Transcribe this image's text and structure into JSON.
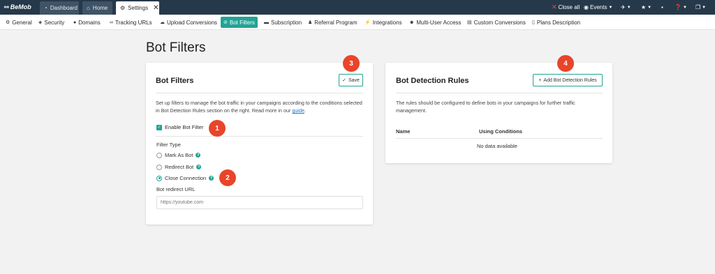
{
  "app": {
    "logo": "BeMob"
  },
  "top_tabs": [
    {
      "label": "Dashboard"
    },
    {
      "label": "Home"
    },
    {
      "label": "Settings"
    }
  ],
  "top_right": {
    "close_all": "Close all",
    "events": "Events"
  },
  "nav": [
    {
      "label": "General"
    },
    {
      "label": "Security"
    },
    {
      "label": "Domains"
    },
    {
      "label": "Tracking URLs"
    },
    {
      "label": "Upload Conversions"
    },
    {
      "label": "Bot Filters"
    },
    {
      "label": "Subscription"
    },
    {
      "label": "Referral Program"
    },
    {
      "label": "Integrations"
    },
    {
      "label": "Multi-User Access"
    },
    {
      "label": "Custom Conversions"
    },
    {
      "label": "Plans Description"
    }
  ],
  "page": {
    "title": "Bot Filters"
  },
  "bot_filters": {
    "title": "Bot Filters",
    "save_label": "Save",
    "description": "Set up filters to manage the bot traffic in your campaigns according to the conditions selected in Bot Detection Rules section on the right. Read more in our",
    "description_link": "guide",
    "enable_label": "Enable Bot Filter",
    "enabled": true,
    "filter_type_label": "Filter Type",
    "options": [
      {
        "label": "Mark As Bot",
        "selected": false
      },
      {
        "label": "Redirect Bot",
        "selected": false
      },
      {
        "label": "Close Connection",
        "selected": true
      }
    ],
    "redirect_url_label": "Bot redirect URL",
    "redirect_url_placeholder": "https://youtube.com",
    "redirect_url_value": ""
  },
  "detection_rules": {
    "title": "Bot Detection Rules",
    "add_label": "Add Bot Detection Rules",
    "description": "The rules should be configured to define bots in your campaigns for further traffic management.",
    "columns": [
      "Name",
      "Using Conditions"
    ],
    "empty_text": "No data available"
  },
  "annotations": [
    "1",
    "2",
    "3",
    "4"
  ],
  "colors": {
    "accent": "#22a394",
    "topbar": "#26394a",
    "badge": "#e8452a"
  }
}
